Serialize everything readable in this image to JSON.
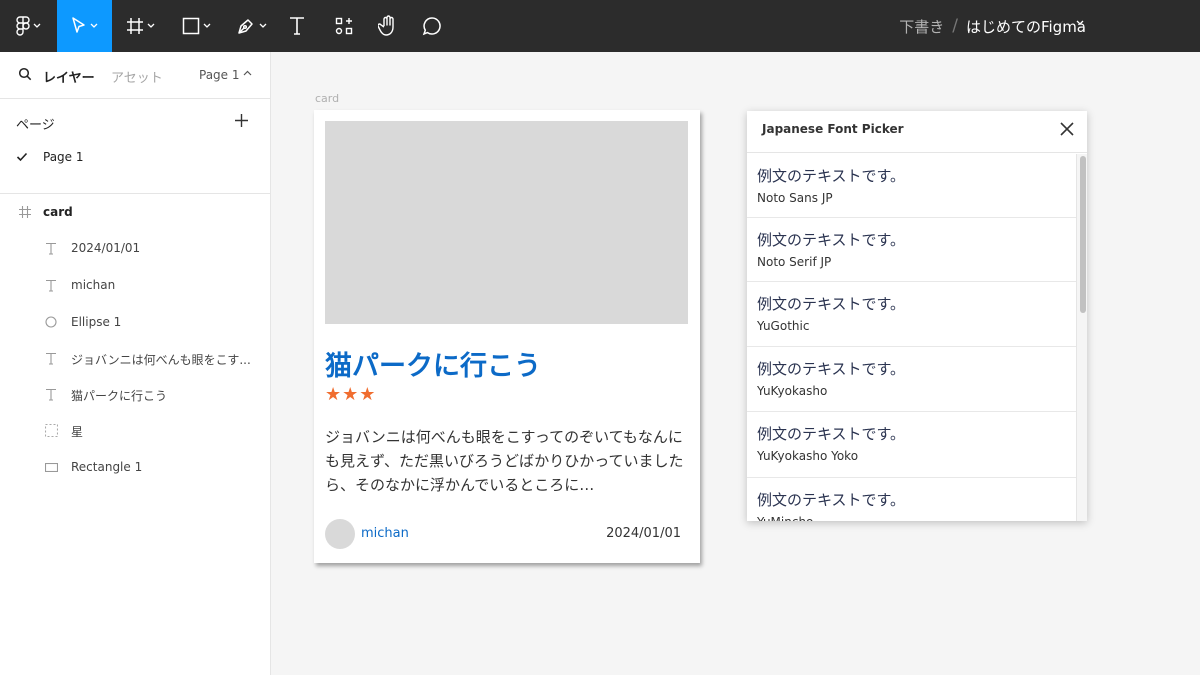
{
  "toolbar": {
    "file_breadcrumb": {
      "draft": "下書き",
      "separator": "/",
      "file_name": "はじめてのFigma"
    },
    "tools": [
      "main-menu",
      "move",
      "frame",
      "shape",
      "pen",
      "text",
      "resources",
      "hand",
      "comment"
    ],
    "active_tool": "move",
    "colors": {
      "bar": "#2c2c2c",
      "active": "#0d99ff"
    }
  },
  "left_panel": {
    "tabs": {
      "layers": "レイヤー",
      "assets": "アセット"
    },
    "page_selector": "Page 1",
    "pages_label": "ページ",
    "pages": [
      {
        "label": "Page 1",
        "selected": true
      }
    ],
    "layers": [
      {
        "label": "card",
        "icon": "frame-icon"
      },
      {
        "label": "2024/01/01",
        "icon": "text-icon"
      },
      {
        "label": "michan",
        "icon": "text-icon"
      },
      {
        "label": "Ellipse 1",
        "icon": "ellipse-icon"
      },
      {
        "label": "ジョバンニは何べんも眼をこす...",
        "icon": "text-icon"
      },
      {
        "label": "猫パークに行こう",
        "icon": "text-icon"
      },
      {
        "label": "星",
        "icon": "group-icon"
      },
      {
        "label": "Rectangle 1",
        "icon": "rectangle-icon"
      }
    ]
  },
  "canvas": {
    "frame_label": "card",
    "card": {
      "title": "猫パークに行こう",
      "stars": "★★★",
      "body": "ジョバンニは何べんも眼をこすってのぞいてもなんにも見えず、ただ黒いびろうどばかりひかっていましたら、そのなかに浮かんでいるところに…",
      "author": "michan",
      "date": "2024/01/01",
      "colors": {
        "title": "#0c6ac7",
        "stars": "#f06d2f",
        "placeholder": "#d9d9d9"
      }
    }
  },
  "font_picker": {
    "title": "Japanese Font Picker",
    "items": [
      {
        "sample": "例文のテキストです。",
        "font": "Noto Sans JP"
      },
      {
        "sample": "例文のテキストです。",
        "font": "Noto Serif JP"
      },
      {
        "sample": "例文のテキストです。",
        "font": "YuGothic"
      },
      {
        "sample": "例文のテキストです。",
        "font": "YuKyokasho"
      },
      {
        "sample": "例文のテキストです。",
        "font": "YuKyokasho Yoko"
      },
      {
        "sample": "例文のテキストです。",
        "font": "YuMincho"
      }
    ]
  }
}
